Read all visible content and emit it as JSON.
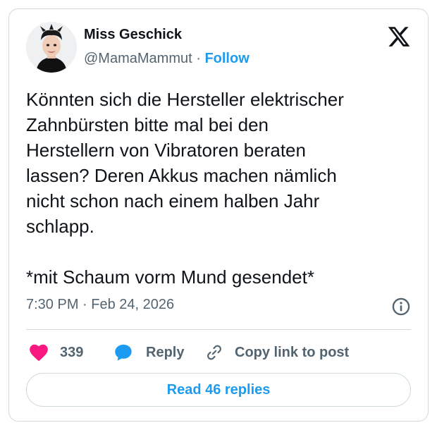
{
  "author": {
    "name": "Miss Geschick",
    "handle": "@MamaMammut",
    "separator": " · ",
    "follow_label": "Follow"
  },
  "tweet": {
    "text": "Könnten sich die Hersteller elektrischer\nZahnbürsten bitte mal bei den\nHerstellern von Vibratoren beraten\nlassen? Deren Akkus machen nämlich\nnicht schon nach einem halben Jahr\nschlapp.\n\n*mit Schaum vorm Mund gesendet*",
    "time": "7:30 PM · Feb 24, 2026"
  },
  "actions": {
    "like_count": "339",
    "reply_label": "Reply",
    "copy_label": "Copy link to post"
  },
  "read_replies_label": "Read 46 replies",
  "icons": {
    "logo": "x-logo-icon",
    "info": "info-icon",
    "like": "heart-icon",
    "reply": "speech-bubble-icon",
    "copy": "link-icon"
  },
  "colors": {
    "accent": "#1d9bf0",
    "like": "#f91880",
    "muted": "#536471",
    "text": "#0f1419",
    "border": "#cfd9de"
  }
}
